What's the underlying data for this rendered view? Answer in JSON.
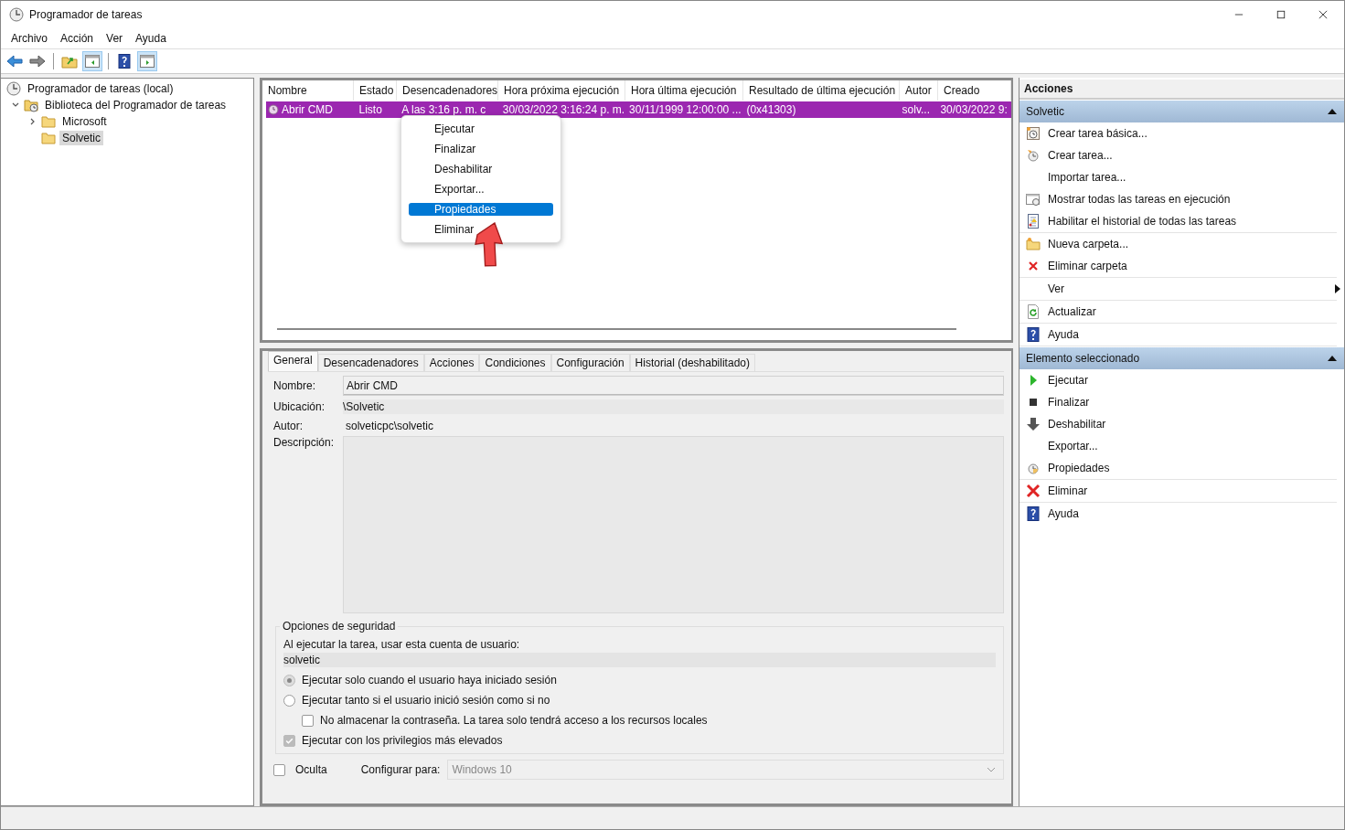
{
  "window": {
    "title": "Programador de tareas"
  },
  "menu": [
    "Archivo",
    "Acción",
    "Ver",
    "Ayuda"
  ],
  "toolbar": [
    {
      "kind": "back",
      "pressed": false
    },
    {
      "kind": "forward",
      "pressed": false
    },
    {
      "kind": "up-folder",
      "pressed": false
    },
    {
      "kind": "pane-left",
      "pressed": true
    },
    {
      "kind": "help",
      "pressed": false
    },
    {
      "kind": "pane-right",
      "pressed": true
    }
  ],
  "tree": [
    {
      "label": "Programador de tareas (local)",
      "kind": "clock",
      "selected": false,
      "children": [
        {
          "label": "Biblioteca del Programador de tareas",
          "kind": "clock-folder",
          "expanded": true,
          "selected": false,
          "children": [
            {
              "label": "Microsoft",
              "kind": "folder",
              "expanded": false,
              "selected": false
            },
            {
              "label": "Solvetic",
              "kind": "folder",
              "selected": true
            }
          ]
        }
      ]
    }
  ],
  "table": {
    "columns": [
      "Nombre",
      "Estado",
      "Desencadenadores",
      "Hora próxima ejecución",
      "Hora última ejecución",
      "Resultado de última ejecución",
      "Autor",
      "Creado"
    ],
    "rows": [
      {
        "selected": true,
        "cells": [
          "Abrir CMD",
          "Listo",
          "A las 3:16 p. m. c",
          "30/03/2022 3:16:24 p. m.",
          "30/11/1999 12:00:00 ...",
          "(0x41303)",
          "solv...",
          "30/03/2022 9:"
        ]
      }
    ]
  },
  "context_menu": [
    {
      "label": "Ejecutar",
      "selected": false
    },
    {
      "label": "Finalizar",
      "selected": false
    },
    {
      "label": "Deshabilitar",
      "selected": false
    },
    {
      "label": "Exportar...",
      "selected": false
    },
    {
      "label": "Propiedades",
      "selected": true
    },
    {
      "label": "Eliminar",
      "selected": false
    }
  ],
  "tabs": [
    {
      "label": "General",
      "selected": true
    },
    {
      "label": "Desencadenadores",
      "selected": false
    },
    {
      "label": "Acciones",
      "selected": false
    },
    {
      "label": "Condiciones",
      "selected": false
    },
    {
      "label": "Configuración",
      "selected": false
    },
    {
      "label": "Historial (deshabilitado)",
      "selected": false
    }
  ],
  "general": {
    "name_label": "Nombre:",
    "name": "Abrir CMD",
    "location_label": "Ubicación:",
    "location": "\\Solvetic",
    "author_label": "Autor:",
    "author": "solveticpc\\solvetic",
    "description_label": "Descripción:"
  },
  "security": {
    "title": "Opciones de seguridad",
    "account_label": "Al ejecutar la tarea, usar esta cuenta de usuario:",
    "account": "solvetic",
    "options": [
      {
        "kind": "radio",
        "label": "Ejecutar solo cuando el usuario haya iniciado sesión",
        "checked": true,
        "indented": false
      },
      {
        "kind": "radio",
        "label": "Ejecutar tanto si el usuario inició sesión como si no",
        "checked": false,
        "indented": false
      },
      {
        "kind": "checkbox",
        "label": "No almacenar la contraseña. La tarea solo tendrá acceso a los recursos locales",
        "checked": false,
        "indented": true
      },
      {
        "kind": "checkbox",
        "label": "Ejecutar con los privilegios más elevados",
        "checked": true,
        "indented": false
      }
    ]
  },
  "hidden": {
    "label": "Oculta",
    "checked": false
  },
  "configure_for": {
    "label": "Configurar para:",
    "value": "Windows 10"
  },
  "actions": {
    "title": "Acciones",
    "sections": [
      {
        "title": "Solvetic",
        "expanded": true,
        "groups": [
          [
            {
              "label": "Crear tarea básica...",
              "kind": "basic-task"
            },
            {
              "label": "Crear tarea...",
              "kind": "task"
            },
            {
              "label": "Importar tarea...",
              "kind": "plain"
            },
            {
              "label": "Mostrar todas las tareas en ejecución",
              "kind": "running"
            },
            {
              "label": "Habilitar el historial de todas las tareas",
              "kind": "history"
            }
          ],
          [
            {
              "label": "Nueva carpeta...",
              "kind": "new-folder"
            },
            {
              "label": "Eliminar carpeta",
              "kind": "delete"
            }
          ],
          [
            {
              "label": "Ver",
              "kind": "submenu"
            }
          ],
          [
            {
              "label": "Actualizar",
              "kind": "refresh"
            }
          ],
          [
            {
              "label": "Ayuda",
              "kind": "help"
            }
          ]
        ]
      },
      {
        "title": "Elemento seleccionado",
        "expanded": true,
        "groups": [
          [
            {
              "label": "Ejecutar",
              "kind": "run"
            },
            {
              "label": "Finalizar",
              "kind": "stop"
            },
            {
              "label": "Deshabilitar",
              "kind": "disable"
            },
            {
              "label": "Exportar...",
              "kind": "plain"
            },
            {
              "label": "Propiedades",
              "kind": "properties"
            }
          ],
          [
            {
              "label": "Eliminar",
              "kind": "delete-big"
            }
          ],
          [
            {
              "label": "Ayuda",
              "kind": "help"
            }
          ]
        ]
      }
    ]
  }
}
